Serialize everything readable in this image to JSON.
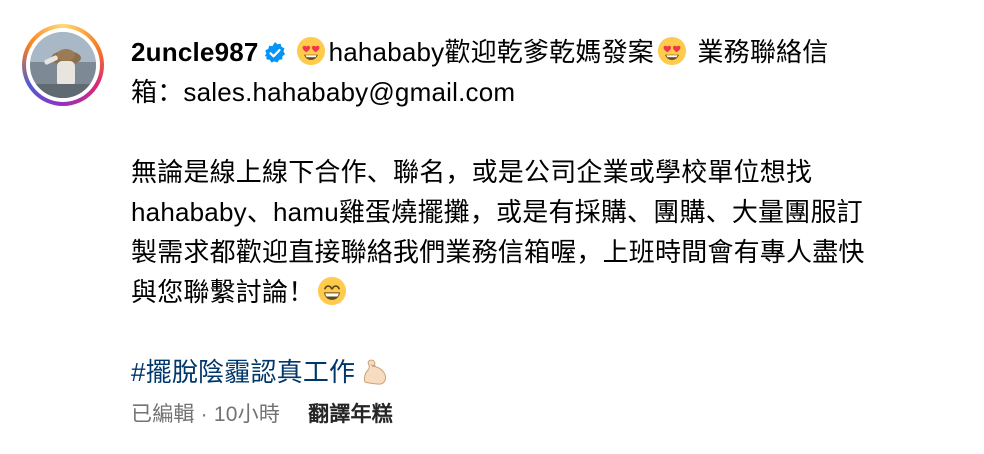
{
  "post": {
    "username": "2uncle987",
    "bio_line_1": "hahababy歡迎乾爹乾媽發案",
    "bio_line_1b": "業務聯絡信",
    "bio_line_2": "箱：sales.hahababy@gmail.com",
    "paragraph": [
      "無論是線上線下合作、聯名，或是公司企業或學校單位想找",
      "hahababy、hamu雞蛋燒擺攤，或是有採購、團購、大量團服訂",
      "製需求都歡迎直接聯絡我們業務信箱喔，上班時間會有專人盡快",
      "與您聯繫討論！"
    ],
    "hashtag": "#擺脫陰霾認真工作",
    "edited": "已編輯",
    "separator": "·",
    "time": "10小時",
    "translate": "翻譯年糕"
  },
  "icons": {
    "verified": "verified-badge-icon",
    "heart_eyes": "heart-eyes-emoji",
    "grin": "grinning-emoji",
    "muscle": "flexed-biceps-emoji"
  },
  "colors": {
    "text": "#000000",
    "hashtag": "#00376b",
    "meta": "#737373",
    "verified": "#0095f6"
  }
}
